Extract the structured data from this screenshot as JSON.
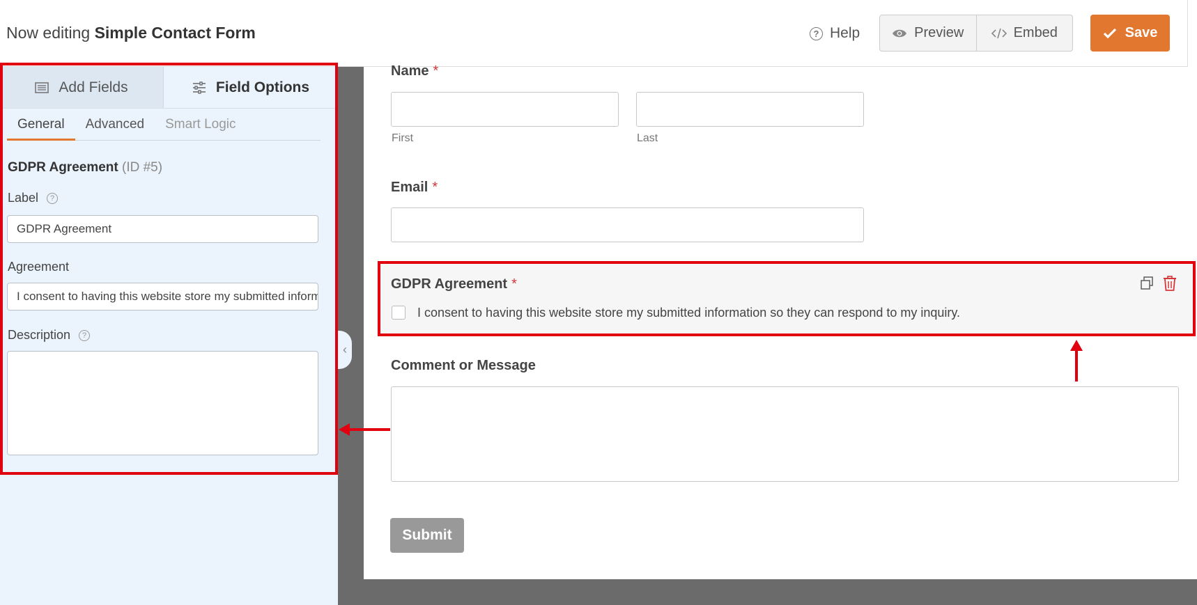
{
  "header": {
    "editing_prefix": "Now editing",
    "form_name": "Simple Contact Form",
    "help_label": "Help",
    "preview_label": "Preview",
    "embed_label": "Embed",
    "save_label": "Save",
    "accent_color": "#e27730"
  },
  "sidebar": {
    "tabs": [
      {
        "label": "Add Fields",
        "icon": "list-icon"
      },
      {
        "label": "Field Options",
        "icon": "sliders-icon"
      }
    ],
    "subtabs": [
      {
        "label": "General",
        "active": true
      },
      {
        "label": "Advanced",
        "active": false
      },
      {
        "label": "Smart Logic",
        "active": false,
        "disabled": true
      }
    ],
    "field_title": "GDPR Agreement",
    "field_id": "(ID #5)",
    "label_label": "Label",
    "label_value": "GDPR Agreement",
    "agreement_label": "Agreement",
    "agreement_value": "I consent to having this website store my submitted information so they can respond to my inquiry.",
    "description_label": "Description",
    "description_value": ""
  },
  "form": {
    "name_label": "Name",
    "first_sublabel": "First",
    "last_sublabel": "Last",
    "email_label": "Email",
    "gdpr_label": "GDPR Agreement",
    "gdpr_consent": "I consent to having this website store my submitted information so they can respond to my inquiry.",
    "comment_label": "Comment or Message",
    "submit_label": "Submit",
    "required_marker": "*"
  }
}
